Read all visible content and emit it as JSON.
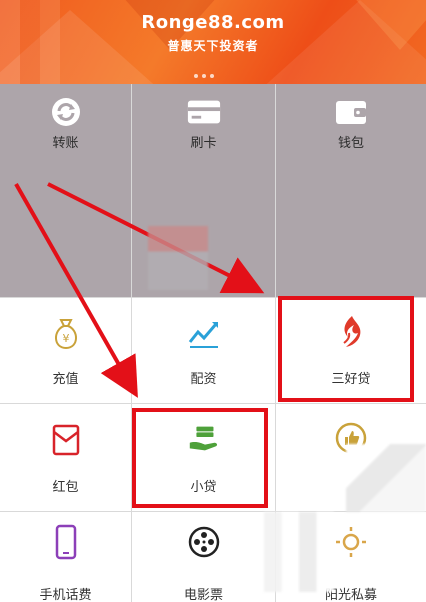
{
  "banner": {
    "site": "Ronge88.com",
    "slogan": "普惠天下投资者"
  },
  "grid": {
    "row1": [
      {
        "label": "转账",
        "icon": "transfer-refresh-icon"
      },
      {
        "label": "刷卡",
        "icon": "card-icon"
      },
      {
        "label": "钱包",
        "icon": "wallet-icon"
      }
    ],
    "row2": [
      {
        "label": "充值",
        "icon": "money-bag-icon"
      },
      {
        "label": "配资",
        "icon": "trend-chart-icon"
      },
      {
        "label": "三好贷",
        "icon": "flame-logo-icon"
      }
    ],
    "row3": [
      {
        "label": "红包",
        "icon": "red-envelope-icon"
      },
      {
        "label": "小贷",
        "icon": "cash-hand-icon"
      },
      {
        "label": "",
        "icon": "thumbs-up-badge-icon"
      }
    ],
    "row4": [
      {
        "label": "手机话费",
        "icon": "phone-icon"
      },
      {
        "label": "电影票",
        "icon": "film-reel-icon"
      },
      {
        "label": "阳光私募",
        "icon": "sun-icon"
      }
    ]
  },
  "colors": {
    "banner": "#f05a1e",
    "highlight": "#e31018",
    "gray_overlay": "#ada5aa"
  }
}
